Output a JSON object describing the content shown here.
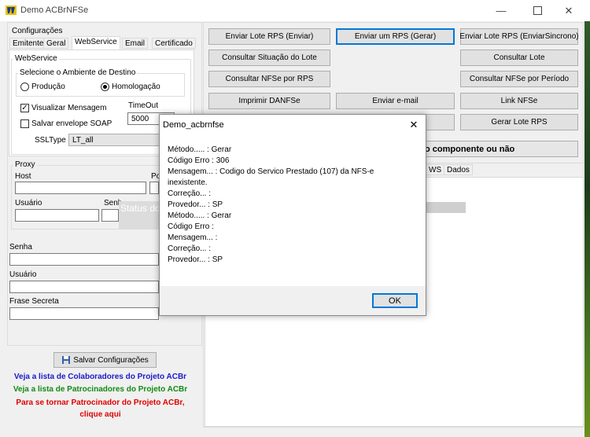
{
  "window": {
    "title": "Demo ACBrNFSe"
  },
  "left": {
    "config_label": "Configurações",
    "tabs": [
      "Emitente",
      "Geral",
      "WebService",
      "Email",
      "Certificado"
    ],
    "webservice_group": "WebService",
    "ambiente_group": "Selecione o Ambiente de Destino",
    "radio_producao": "Produção",
    "radio_homologacao": "Homologação",
    "chk_visualizar": "Visualizar Mensagem",
    "chk_salvar": "Salvar envelope SOAP",
    "timeout_label": "TimeOut",
    "timeout_value": "5000",
    "ssltype_label": "SSLType",
    "ssltype_value": "LT_all",
    "proxy_group": "Proxy",
    "host_label": "Host",
    "porta_label": "Po",
    "usuario_label": "Usuário",
    "senha_label_short": "Senh",
    "status_overlay": "Status do",
    "senha_label": "Senha",
    "usuario2_label": "Usuário",
    "frase_label": "Frase Secreta",
    "save_button": "Salvar Configurações",
    "links": {
      "colaboradores": "Veja a lista de Colaboradores do Projeto ACBr",
      "patrocinadores": "Veja a lista de Patrocinadores do Projeto ACBr",
      "tornar1": "Para se tornar Patrocinador do Projeto ACBr,",
      "tornar2": "clique aqui"
    }
  },
  "right": {
    "buttons": {
      "enviar_lote_rps": "Enviar Lote RPS (Enviar)",
      "enviar_um_rps": "Enviar um RPS (Gerar)",
      "enviar_lote_sincrono": "Enviar Lote RPS (EnviarSincrono)",
      "consultar_situacao": "Consultar Situação do Lote",
      "consultar_lote": "Consultar Lote",
      "consultar_nfse_rps": "Consultar NFSe por RPS",
      "consultar_nfse_periodo": "Consultar NFSe por Período",
      "imprimir_danfse": "Imprimir DANFSe",
      "enviar_email": "Enviar e-mail",
      "link_nfse": "Link NFSe",
      "gerar_lote_rps": "Gerar Lote RPS"
    },
    "banner_text": "o componente ou não",
    "tabs": [
      "WS",
      "Dados"
    ]
  },
  "dialog": {
    "title": "Demo_acbrnfse",
    "lines": [
      "Método..... : Gerar",
      "Código Erro : 306",
      "Mensagem... : Codigo do Servico Prestado (107) da NFS-e",
      "inexistente.",
      "Correção... :",
      "Provedor... : SP",
      "Método..... : Gerar",
      "Código Erro :",
      "Mensagem... :",
      "Correção... :",
      "Provedor... : SP"
    ],
    "ok_label": "OK"
  }
}
